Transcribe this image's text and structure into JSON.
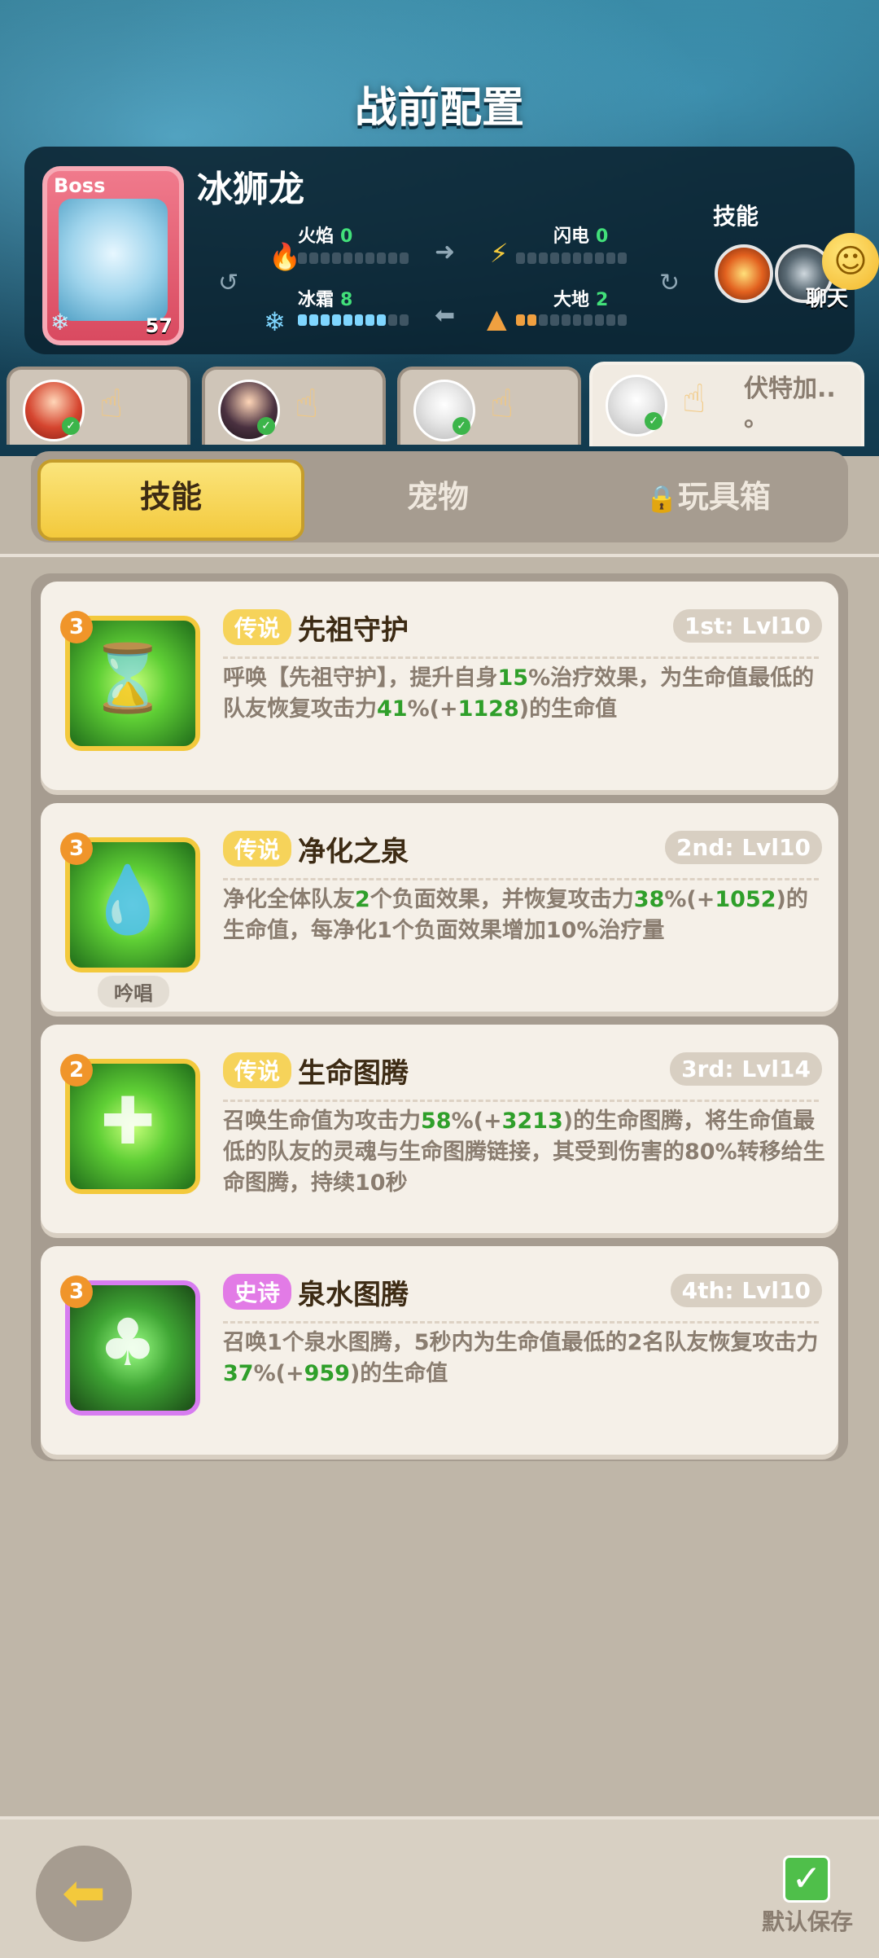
{
  "page_title": "战前配置",
  "boss": {
    "tag": "Boss",
    "name": "冰狮龙",
    "level": "57",
    "stats": [
      {
        "label": "火焰",
        "value": "0",
        "icon": "fire-icon"
      },
      {
        "label": "闪电",
        "value": "0",
        "icon": "lightning-icon"
      },
      {
        "label": "冰霜",
        "value": "8",
        "icon": "snowflake-icon"
      },
      {
        "label": "大地",
        "value": "2",
        "icon": "earth-icon"
      }
    ],
    "skills_label": "技能"
  },
  "chat_label": "聊天",
  "heroes": [
    {
      "name": "",
      "icon": "red-hair-hero-avatar"
    },
    {
      "name": "",
      "icon": "dark-hair-hero-avatar"
    },
    {
      "name": "",
      "icon": "white-hair-hero-avatar"
    },
    {
      "name": "伏特加..\n。",
      "icon": "white-hair-hero-avatar",
      "active": true
    }
  ],
  "tabs": [
    {
      "label": "技能",
      "active": true
    },
    {
      "label": "宠物",
      "active": false
    },
    {
      "label": "玩具箱",
      "active": false,
      "locked": true
    }
  ],
  "skills": [
    {
      "level": "3",
      "rarity": "传说",
      "name": "先祖守护",
      "slot": "1st: Lvl10",
      "desc_parts": [
        "呼唤【先祖守护】，提升自身",
        "15",
        "%治疗效果，为生命值最低的队友恢复攻击力",
        "41",
        "%(+",
        "1128",
        ")的生命值"
      ],
      "icon": "ancestral-guardian-icon"
    },
    {
      "level": "3",
      "rarity": "传说",
      "name": "净化之泉",
      "slot": "2nd: Lvl10",
      "desc_parts": [
        "净化全体队友",
        "2",
        "个负面效果，并恢复攻击力",
        "38",
        "%(+",
        "1052",
        ")的生命值，每净化1个负面效果增加10%治疗量"
      ],
      "chant": "吟唱",
      "icon": "purify-spring-icon"
    },
    {
      "level": "2",
      "rarity": "传说",
      "name": "生命图腾",
      "slot": "3rd: Lvl14",
      "desc_parts": [
        "召唤生命值为攻击力",
        "58",
        "%(+",
        "3213",
        ")的生命图腾，将生命值最低的队友的灵魂与生命图腾链接，其受到伤害的80%转移给生命图腾，持续10秒"
      ],
      "icon": "life-totem-icon"
    },
    {
      "level": "3",
      "rarity": "史诗",
      "name": "泉水图腾",
      "slot": "4th: Lvl10",
      "desc_parts": [
        "召唤1个泉水图腾，5秒内为生命值最低的2名队友恢复攻击力",
        "37",
        "%(+",
        "959",
        ")的生命值"
      ],
      "icon": "spring-totem-icon"
    }
  ],
  "bottom": {
    "default_save_label": "默认保存"
  }
}
